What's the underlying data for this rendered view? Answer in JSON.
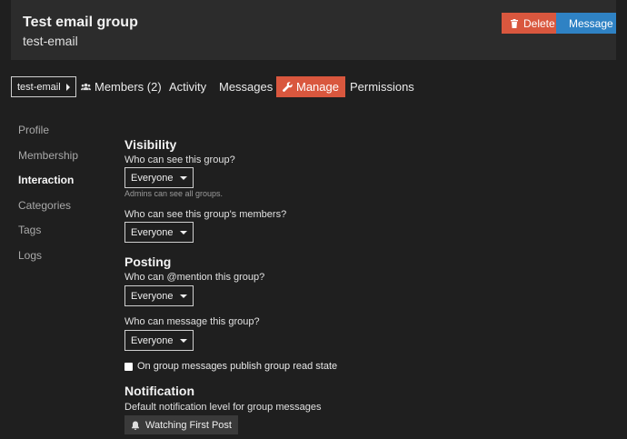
{
  "header": {
    "title": "Test email group",
    "subtitle": "test-email",
    "delete_label": "Delete",
    "message_label": "Message"
  },
  "nav": {
    "crumb": "test-email",
    "tabs": {
      "members": "Members (2)",
      "activity": "Activity",
      "messages": "Messages",
      "manage": "Manage",
      "permissions": "Permissions"
    },
    "active_tab": "Manage"
  },
  "sidebar": {
    "items": [
      {
        "label": "Profile"
      },
      {
        "label": "Membership"
      },
      {
        "label": "Interaction"
      },
      {
        "label": "Categories"
      },
      {
        "label": "Tags"
      },
      {
        "label": "Logs"
      }
    ],
    "active": "Interaction"
  },
  "visibility": {
    "title": "Visibility",
    "see_group_q": "Who can see this group?",
    "see_group_value": "Everyone",
    "see_group_hint": "Admins can see all groups.",
    "see_members_q": "Who can see this group's members?",
    "see_members_value": "Everyone"
  },
  "posting": {
    "title": "Posting",
    "mention_q": "Who can @mention this group?",
    "mention_value": "Everyone",
    "message_q": "Who can message this group?",
    "message_value": "Everyone",
    "publish_read_state_label": "On group messages publish group read state",
    "publish_read_state_checked": false
  },
  "notification": {
    "title": "Notification",
    "level_q": "Default notification level for group messages",
    "level_value": "Watching First Post"
  },
  "colors": {
    "accent_red": "#d9573e",
    "accent_blue": "#2f82c4",
    "background": "#1f1f1f",
    "header_bg": "#2c2c2c"
  }
}
